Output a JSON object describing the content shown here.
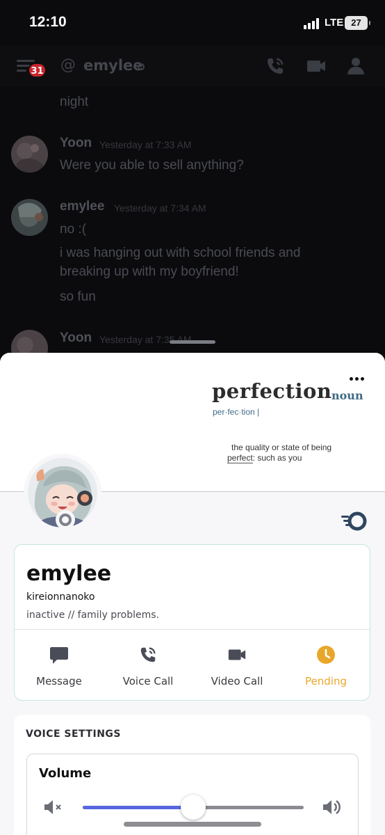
{
  "status_bar": {
    "time": "12:10",
    "network": "LTE",
    "battery": "27"
  },
  "header": {
    "badge_count": "31",
    "channel_name": "emylee"
  },
  "chat": {
    "messages": [
      {
        "text": "night"
      },
      {
        "author": "Yoon",
        "timestamp": "Yesterday at 7:33 AM",
        "lines": [
          "Were you able to sell anything?"
        ]
      },
      {
        "author": "emylee",
        "timestamp": "Yesterday at 7:34 AM",
        "lines": [
          "no :(",
          "i was hanging out with school friends and",
          "breaking up with my boyfriend!",
          "so fun"
        ]
      },
      {
        "author": "Yoon",
        "timestamp": "Yesterday at 7:35 AM"
      }
    ]
  },
  "banner": {
    "word": "perfection",
    "part_of_speech": "noun",
    "pronunciation": "per·fec·tion  |",
    "definition_line1": "the quality or state of being",
    "definition_perfect": "perfect",
    "definition_rest": ": such as you"
  },
  "profile": {
    "display_name": "emylee",
    "username": "kireionnanoko",
    "custom_status": "inactive // family problems.",
    "actions": {
      "message": "Message",
      "voice_call": "Voice Call",
      "video_call": "Video Call",
      "pending": "Pending"
    }
  },
  "voice_settings": {
    "title": "VOICE SETTINGS",
    "volume_label": "Volume",
    "volume_level": 0.5
  },
  "colors": {
    "accent": "#5866e0",
    "pending": "#e8a72b",
    "badge": "#c8262c"
  }
}
